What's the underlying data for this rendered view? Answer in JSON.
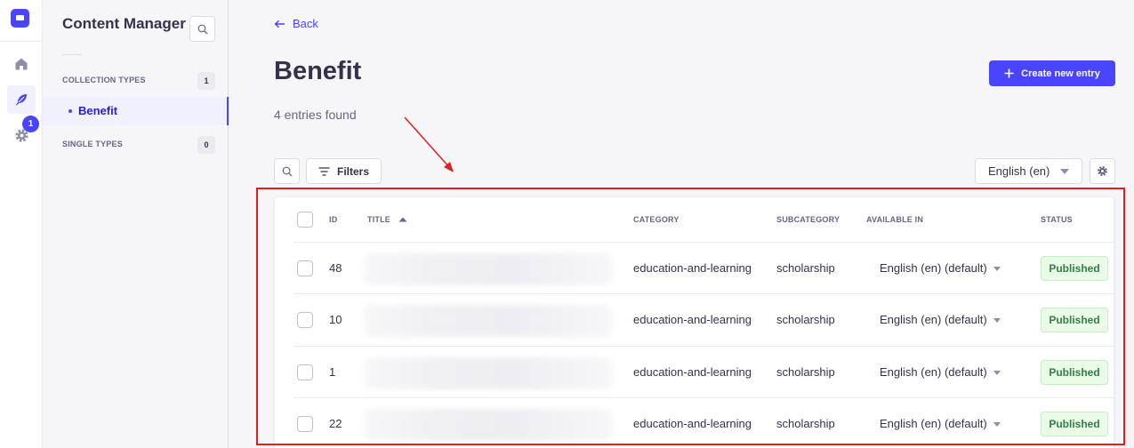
{
  "colors": {
    "accent": "#4945ff",
    "annotation": "#e02020",
    "published_bg": "#eafbe7",
    "published_text": "#328048"
  },
  "rail": {
    "badge": "1"
  },
  "subnav": {
    "title": "Content Manager",
    "collection_types": {
      "label": "COLLECTION TYPES",
      "count": "1"
    },
    "active_item": "Benefit",
    "single_types": {
      "label": "SINGLE TYPES",
      "count": "0"
    }
  },
  "header": {
    "back_label": "Back",
    "title": "Benefit",
    "subtitle": "4 entries found",
    "create_label": "Create new entry"
  },
  "toolbar": {
    "filters_label": "Filters",
    "locale": "English (en)"
  },
  "table": {
    "headers": {
      "id": "ID",
      "title": "TITLE",
      "category": "CATEGORY",
      "subcategory": "SUBCATEGORY",
      "available_in": "AVAILABLE IN",
      "status": "STATUS"
    },
    "rows": [
      {
        "id": "48",
        "category": "education-and-learning",
        "subcategory": "scholarship",
        "available_in": "English (en) (default)",
        "status": "Published"
      },
      {
        "id": "10",
        "category": "education-and-learning",
        "subcategory": "scholarship",
        "available_in": "English (en) (default)",
        "status": "Published"
      },
      {
        "id": "1",
        "category": "education-and-learning",
        "subcategory": "scholarship",
        "available_in": "English (en) (default)",
        "status": "Published"
      },
      {
        "id": "22",
        "category": "education-and-learning",
        "subcategory": "scholarship",
        "available_in": "English (en) (default)",
        "status": "Published"
      }
    ]
  }
}
